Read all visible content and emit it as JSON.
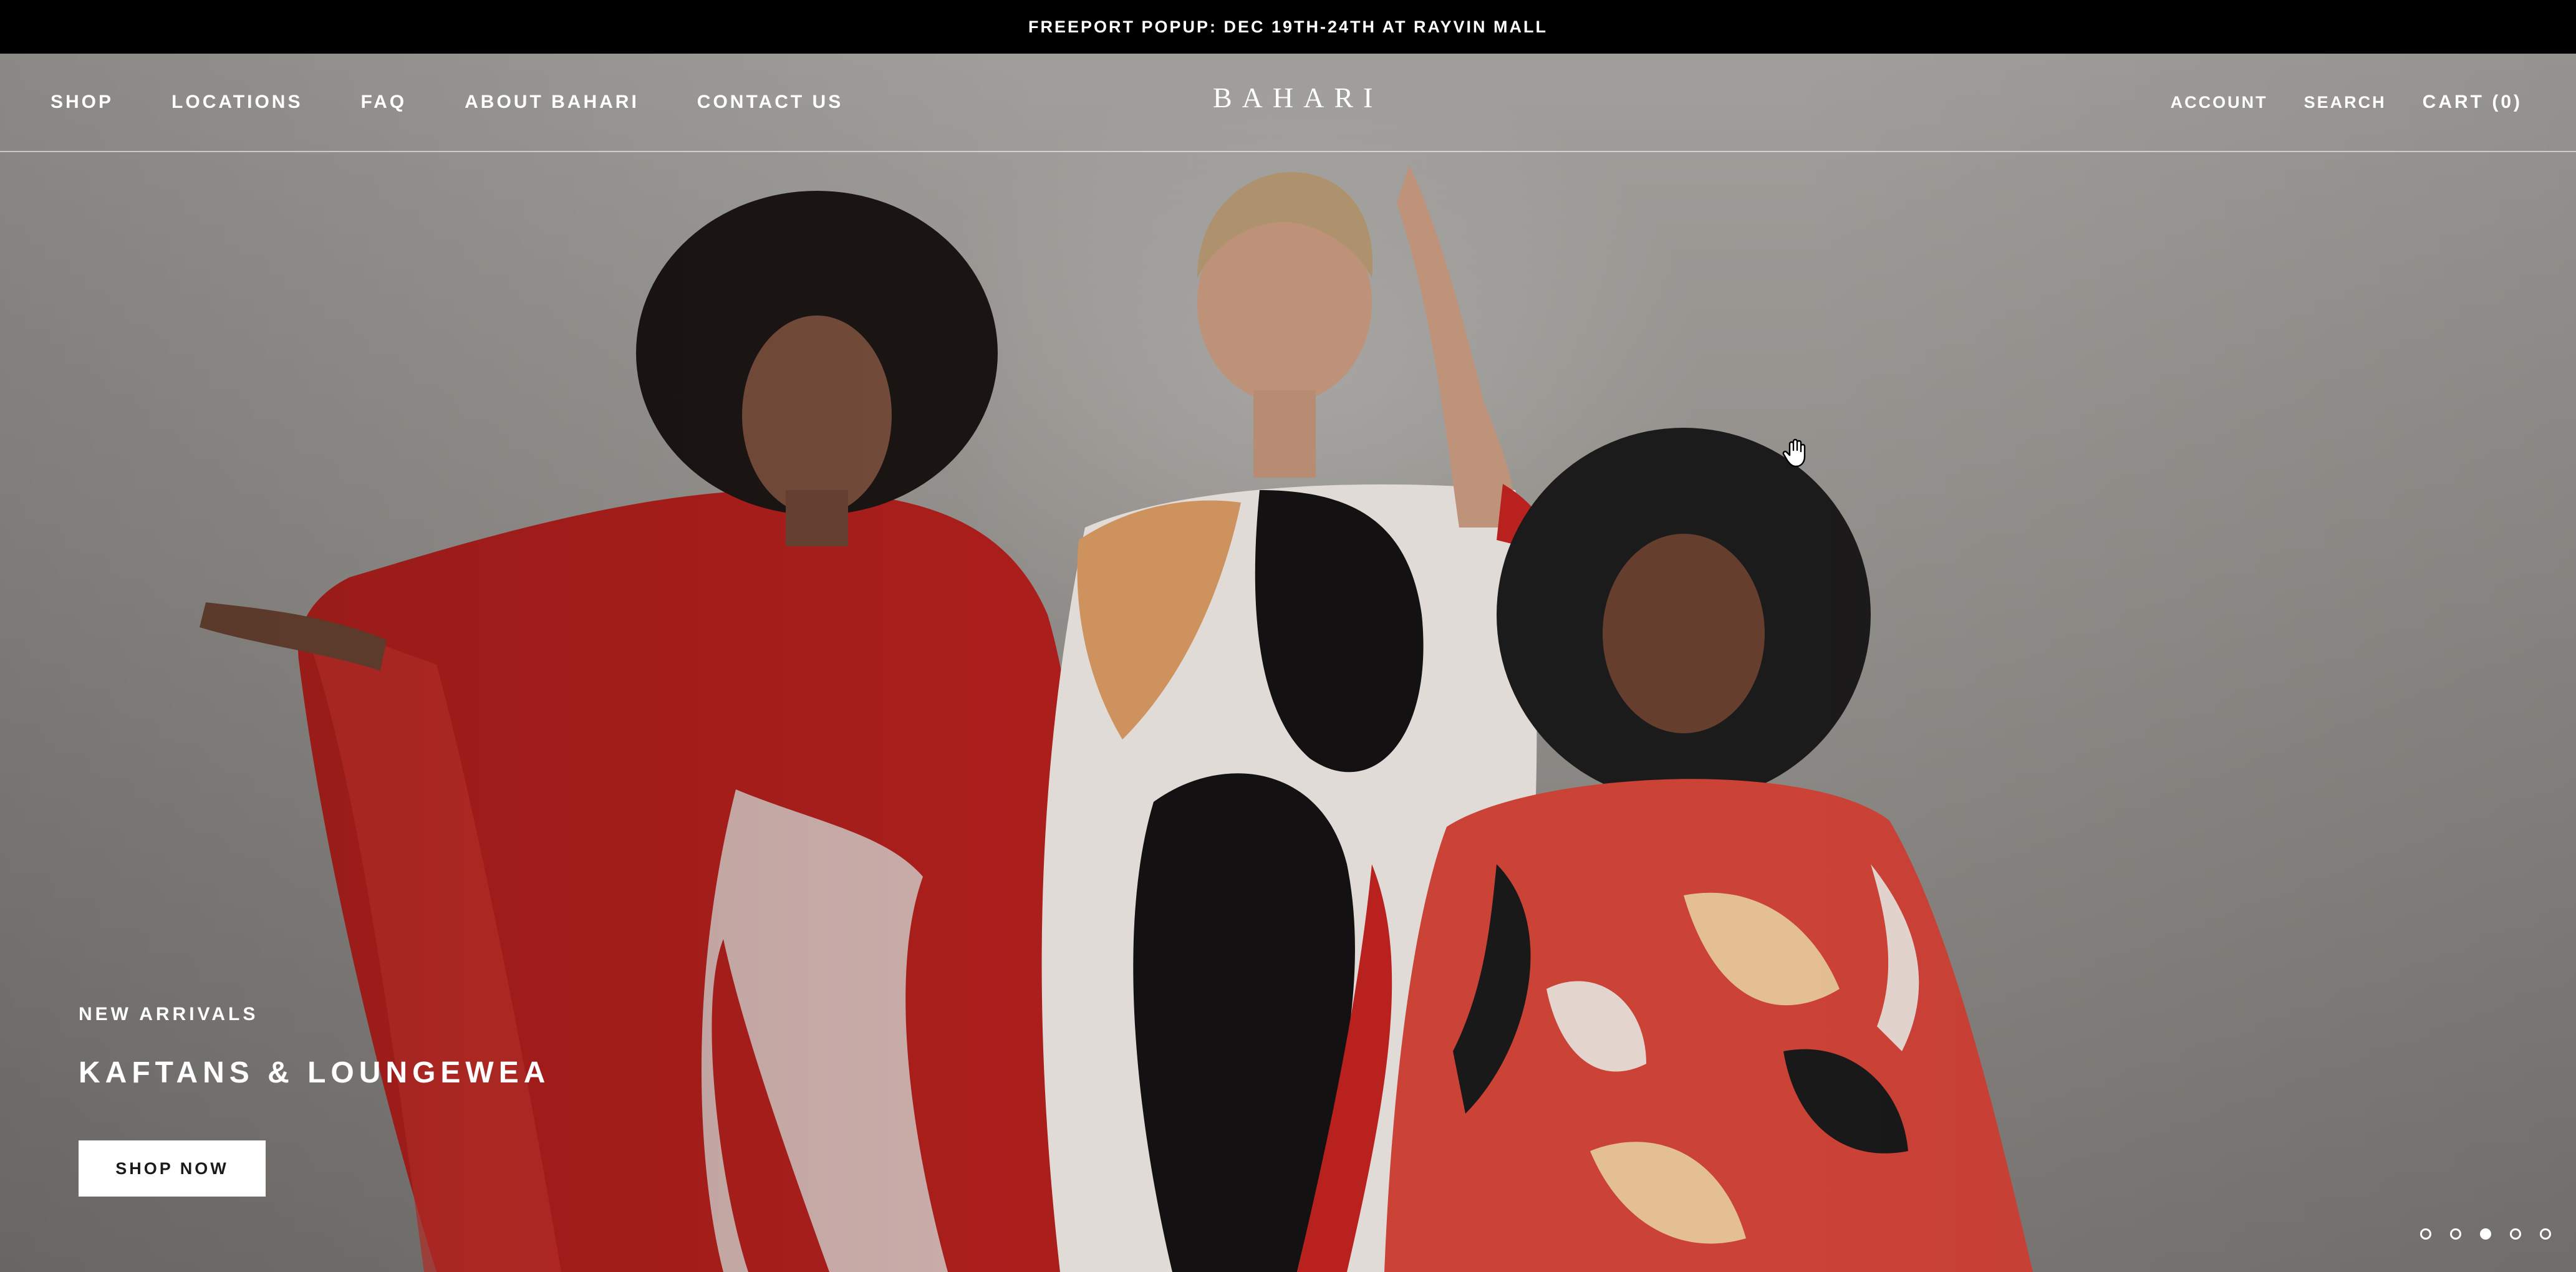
{
  "announcement": {
    "text": "FREEPORT POPUP: DEC 19TH-24TH AT RAYVIN MALL"
  },
  "header": {
    "logo": "BAHARI",
    "nav_left": [
      {
        "label": "SHOP"
      },
      {
        "label": "LOCATIONS"
      },
      {
        "label": "FAQ"
      },
      {
        "label": "ABOUT BAHARI"
      },
      {
        "label": "CONTACT US"
      }
    ],
    "nav_right": {
      "account": "ACCOUNT",
      "search": "SEARCH",
      "cart": "CART (0)"
    }
  },
  "hero": {
    "subtitle": "NEW ARRIVALS",
    "title": "KAFTANS & LOUNGEWEA",
    "cta": "SHOP NOW",
    "slides_total": 5,
    "active_slide": 3
  },
  "colors": {
    "announcement_bg": "#000000",
    "text_on_hero": "#ffffff",
    "button_bg": "#ffffff",
    "kaftan_red": "#c2231f"
  },
  "icons": {
    "cursor": "hand-grab-icon"
  }
}
